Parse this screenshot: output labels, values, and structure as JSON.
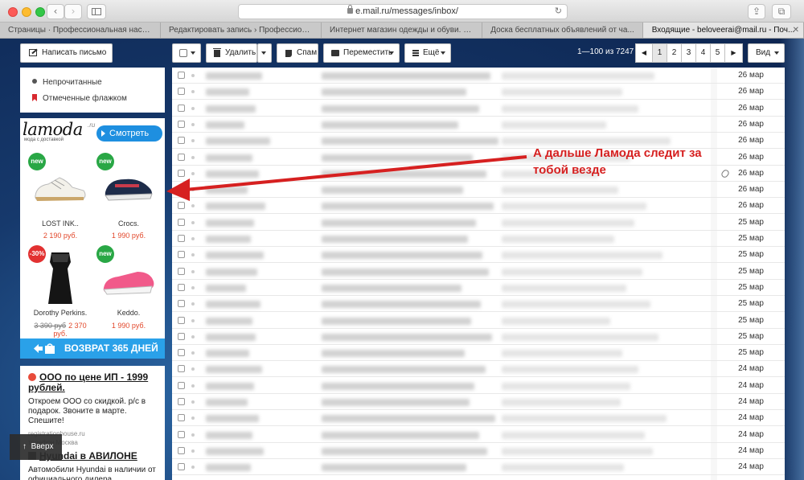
{
  "browser": {
    "url": "e.mail.ru/messages/inbox/",
    "tabs": [
      {
        "label": "Страницы · Профессиональная настро..."
      },
      {
        "label": "Редактировать запись › Профессиона..."
      },
      {
        "label": "Интернет магазин одежды и обуви. К..."
      },
      {
        "label": "Доска бесплатных объявлений от ча..."
      },
      {
        "label": "Входящие - beloveerai@mail.ru - Поч...",
        "active": true
      }
    ]
  },
  "sidebar": {
    "compose_label": "Написать письмо",
    "folders": [
      "Непрочитанные",
      "Отмеченные флажком"
    ]
  },
  "ad": {
    "logo": "lamoda",
    "logo_suffix": ".ru",
    "logo_sub": "мода с доставкой",
    "cta": "Смотреть",
    "products": [
      {
        "name": "LOST INK..",
        "price": "2 190 руб.",
        "badge": "new"
      },
      {
        "name": "Crocs.",
        "price": "1 990 руб.",
        "badge": "new"
      },
      {
        "name": "Dorothy Perkins.",
        "old_price": "3 390 руб",
        "price": "2 370 руб.",
        "badge": "-30%"
      },
      {
        "name": "Keddo.",
        "price": "1 990 руб.",
        "badge": "new"
      }
    ],
    "return_label": "ВОЗВРАТ 365 ДНЕЙ"
  },
  "text_ads": [
    {
      "title": "ООО по цене ИП - 1999 рублей.",
      "body": "Откроем ООО со скидкой. р/с в подарок. Звоните в марте. Спешите!",
      "meta": "registrationhouse.ru"
    },
    {
      "meta2": "телефон   Москва",
      "title": "Hyundai в АВИЛОНЕ",
      "body": "Автомобили Hyundai в наличии от официального дилера"
    }
  ],
  "up_button": "Вверх",
  "toolbar": {
    "delete": "Удалить",
    "spam": "Спам",
    "move": "Переместить",
    "more": "Ещё",
    "range": "1—100 из 7247",
    "pages": [
      "1",
      "2",
      "3",
      "4",
      "5"
    ],
    "view": "Вид"
  },
  "messages": [
    {
      "date": "26 мар"
    },
    {
      "date": "26 мар"
    },
    {
      "date": "26 мар"
    },
    {
      "date": "26 мар"
    },
    {
      "date": "26 мар"
    },
    {
      "date": "26 мар"
    },
    {
      "date": "26 мар",
      "attachment": true
    },
    {
      "date": "26 мар"
    },
    {
      "date": "26 мар"
    },
    {
      "date": "25 мар"
    },
    {
      "date": "25 мар"
    },
    {
      "date": "25 мар"
    },
    {
      "date": "25 мар"
    },
    {
      "date": "25 мар"
    },
    {
      "date": "25 мар"
    },
    {
      "date": "25 мар"
    },
    {
      "date": "25 мар"
    },
    {
      "date": "25 мар"
    },
    {
      "date": "24 мар"
    },
    {
      "date": "24 мар"
    },
    {
      "date": "24 мар"
    },
    {
      "date": "24 мар"
    },
    {
      "date": "24 мар"
    },
    {
      "date": "24 мар"
    },
    {
      "date": "24 мар"
    }
  ],
  "annotation": "А дальше Ламода следит за тобой везде",
  "colors": {
    "annotation": "#d62020",
    "accent": "#2aa1e9",
    "sale": "#e2472a"
  }
}
